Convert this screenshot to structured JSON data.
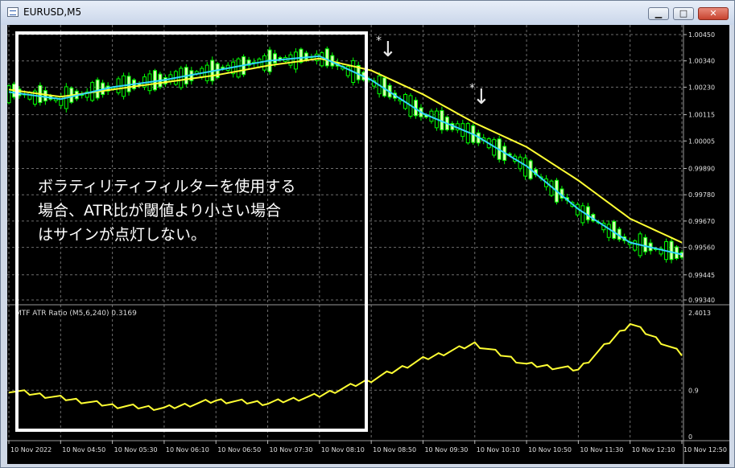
{
  "window": {
    "title": "EURUSD,M5",
    "min_glyph": "▁",
    "max_glyph": "□",
    "close_glyph": "✕"
  },
  "price_axis": [
    "1.00450",
    "1.00340",
    "1.00230",
    "1.00115",
    "1.00005",
    "0.99890",
    "0.99780",
    "0.99670",
    "0.99560",
    "0.99445",
    "0.99340"
  ],
  "indicator_axis": [
    "2.4013",
    "0.9",
    "0"
  ],
  "time_axis": [
    "10 Nov 2022",
    "10 Nov 04:50",
    "10 Nov 05:30",
    "10 Nov 06:10",
    "10 Nov 06:50",
    "10 Nov 07:30",
    "10 Nov 08:10",
    "10 Nov 08:50",
    "10 Nov 09:30",
    "10 Nov 10:10",
    "10 Nov 10:50",
    "10 Nov 11:30",
    "10 Nov 12:10",
    "10 Nov 12:50"
  ],
  "indicator": {
    "label": "MTF ATR Ratio  (M5,6,240) 0.3169"
  },
  "annotation": {
    "lines": [
      "ボラティリティフィルターを使用する",
      "場合、ATR比が閾値より小さい場合",
      "はサインが点灯しない。"
    ]
  },
  "signals": {
    "arrow_1": "↓",
    "arrow_2": "↓"
  },
  "colors": {
    "background": "#000000",
    "grid": "#6e6e6e",
    "candle_up": "#00ff00",
    "candle_body": "#d8ffb0",
    "fast_ma": "#33d6ff",
    "slow_ma": "#ffff33",
    "atr_ratio": "#ffff33",
    "overlay": "#ffffff"
  },
  "chart_data": {
    "type": "line",
    "title": "EURUSD,M5",
    "price_ylim": [
      0.9934,
      1.0045
    ],
    "indicator_ylim": [
      0,
      2.4013
    ],
    "indicator_name": "MTF ATR Ratio",
    "indicator_last_value": 0.3169,
    "x": [
      "10 Nov 2022",
      "10 Nov 04:50",
      "10 Nov 05:30",
      "10 Nov 06:10",
      "10 Nov 06:50",
      "10 Nov 07:30",
      "10 Nov 08:10",
      "10 Nov 08:50",
      "10 Nov 09:30",
      "10 Nov 10:10",
      "10 Nov 10:50",
      "10 Nov 11:30",
      "10 Nov 12:10",
      "10 Nov 12:50"
    ],
    "series": [
      {
        "values": [
          1.0021,
          1.0018,
          1.0023,
          1.0026,
          1.003,
          1.0034,
          1.0036,
          1.0026,
          1.0012,
          1.0003,
          0.999,
          0.9972,
          0.9958,
          0.9953
        ]
      },
      {
        "values": [
          1.0022,
          1.0019,
          1.0022,
          1.0025,
          1.0028,
          1.0032,
          1.0035,
          1.003,
          1.002,
          1.0008,
          0.9998,
          0.9984,
          0.9968,
          0.9958
        ]
      },
      {
        "values": [
          0.9,
          0.75,
          0.6,
          0.55,
          0.7,
          0.65,
          0.8,
          1.1,
          1.5,
          1.8,
          1.4,
          1.3,
          2.2,
          1.6
        ]
      }
    ]
  }
}
